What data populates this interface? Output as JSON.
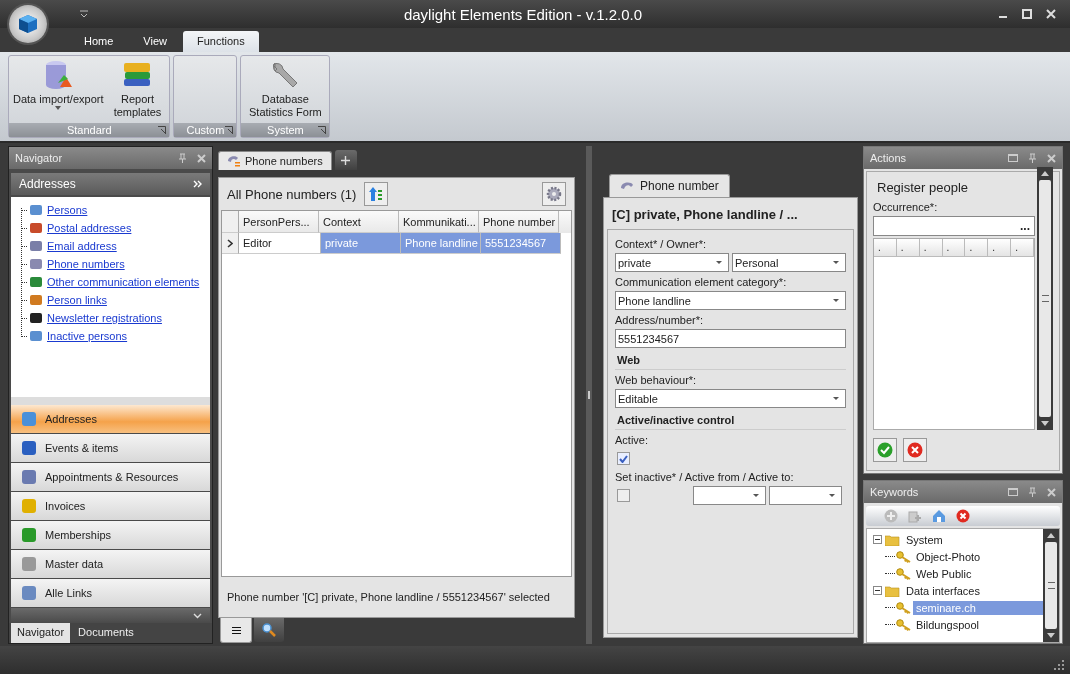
{
  "window": {
    "title": "daylight Elements Edition - v.1.2.0.0"
  },
  "ribbon_tabs": [
    {
      "label": "Home",
      "selected": false
    },
    {
      "label": "View",
      "selected": false
    },
    {
      "label": "Functions",
      "selected": true
    }
  ],
  "ribbon_groups": [
    {
      "label": "Standard",
      "buttons": [
        {
          "label": "Data import/export",
          "dropdown": true
        },
        {
          "label": "Report templates",
          "dropdown": false
        }
      ]
    },
    {
      "label": "Custom"
    },
    {
      "label": "System",
      "buttons": [
        {
          "label": "Database Statistics Form",
          "dropdown": false
        }
      ]
    }
  ],
  "navigator": {
    "title": "Navigator",
    "group_header": "Addresses",
    "tree": [
      {
        "label": "Persons"
      },
      {
        "label": "Postal addresses"
      },
      {
        "label": "Email address"
      },
      {
        "label": "Phone numbers"
      },
      {
        "label": "Other communication elements"
      },
      {
        "label": "Person links"
      },
      {
        "label": "Newsletter registrations"
      },
      {
        "label": "Inactive persons"
      }
    ],
    "sections": [
      {
        "label": "Addresses",
        "selected": true
      },
      {
        "label": "Events & items",
        "selected": false
      },
      {
        "label": "Appointments & Resources",
        "selected": false
      },
      {
        "label": "Invoices",
        "selected": false
      },
      {
        "label": "Memberships",
        "selected": false
      },
      {
        "label": "Master data",
        "selected": false
      },
      {
        "label": "Alle Links",
        "selected": false
      }
    ],
    "bottom_tabs": [
      {
        "label": "Navigator",
        "selected": true
      },
      {
        "label": "Documents",
        "selected": false
      }
    ]
  },
  "document_tabs": [
    {
      "label": "Phone numbers",
      "selected": true
    }
  ],
  "list": {
    "title": "All Phone numbers (1)",
    "columns": [
      "PersonPers...",
      "Context",
      "Kommunikati...",
      "Phone number"
    ],
    "rows": [
      {
        "cells": [
          "Editor",
          "private",
          "Phone landline",
          "5551234567"
        ],
        "selected": true
      }
    ],
    "status": "Phone number '[C] private, Phone landline / 5551234567' selected",
    "view_tabs": [
      {
        "kind": "list",
        "selected": true
      },
      {
        "kind": "search",
        "selected": false
      }
    ]
  },
  "detail": {
    "tab": "Phone number",
    "title": "[C] private, Phone landline / ...",
    "context_label": "Context* / Owner*:",
    "context": "private",
    "owner": "Personal",
    "category_label": "Communication element category*:",
    "category": "Phone landline",
    "address_label": "Address/number*:",
    "address": "5551234567",
    "web_heading": "Web",
    "web_behaviour_label": "Web behaviour*:",
    "web_behaviour": "Editable",
    "active_heading": "Active/inactive control",
    "active_label": "Active:",
    "active_checked": true,
    "inactive_label": "Set inactive* / Active from / Active to:",
    "set_inactive_checked": false
  },
  "actions": {
    "title": "Actions",
    "heading": "Register people",
    "occurrence_label": "Occurrence*:",
    "occurrence_button": "...",
    "grid_headers": [
      ".",
      ".",
      ".",
      ".",
      ".",
      ".",
      "."
    ]
  },
  "keywords": {
    "title": "Keywords",
    "tree": [
      {
        "label": "System",
        "expanded": true,
        "selected": false,
        "children": [
          {
            "label": "Object-Photo",
            "selected": false
          },
          {
            "label": "Web Public",
            "selected": false
          }
        ]
      },
      {
        "label": "Data interfaces",
        "expanded": true,
        "selected": false,
        "children": [
          {
            "label": "seminare.ch",
            "selected": true
          },
          {
            "label": "Bildungspool",
            "selected": false
          }
        ]
      }
    ]
  }
}
